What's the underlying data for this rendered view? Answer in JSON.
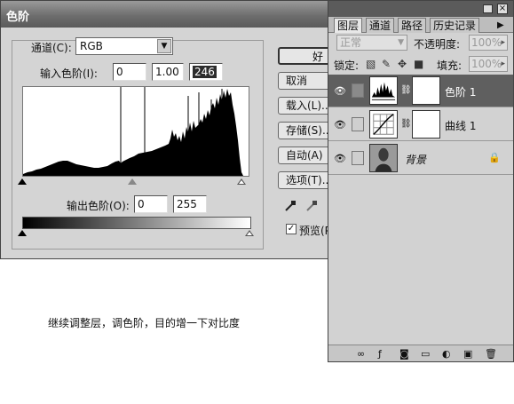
{
  "dialog": {
    "title": "色阶",
    "channel_label": "通道(C):",
    "channel_value": "RGB",
    "input_label": "输入色阶(I):",
    "input_values": [
      "0",
      "1.00",
      "246"
    ],
    "output_label": "输出色阶(O):",
    "output_values": [
      "0",
      "255"
    ],
    "buttons": [
      "好",
      "取消",
      "载入(L)...",
      "存储(S)...",
      "自动(A)",
      "选项(T)..."
    ],
    "preview_label": "预览(P)",
    "preview_checked": true
  },
  "layers_panel": {
    "tabs": [
      "图层",
      "通道",
      "路径",
      "历史记录"
    ],
    "active_tab": "图层",
    "blend_mode": "正常",
    "opacity_label": "不透明度:",
    "opacity_value": "100%",
    "lock_label": "锁定:",
    "fill_label": "填充:",
    "fill_value": "100%",
    "layers": [
      {
        "name": "色阶 1",
        "icon": "levels-adjustment-icon",
        "selected": true
      },
      {
        "name": "曲线 1",
        "icon": "curves-adjustment-icon",
        "selected": false
      },
      {
        "name": "背景",
        "icon": "photo-thumbnail",
        "selected": false,
        "locked": true
      }
    ]
  },
  "caption": "继续调整层，调色阶，目的增一下对比度",
  "colors": {
    "title_bar": "#6e6e6e",
    "selected_layer": "#5f5f5f",
    "dialog_bg": "#d4d4d4"
  }
}
